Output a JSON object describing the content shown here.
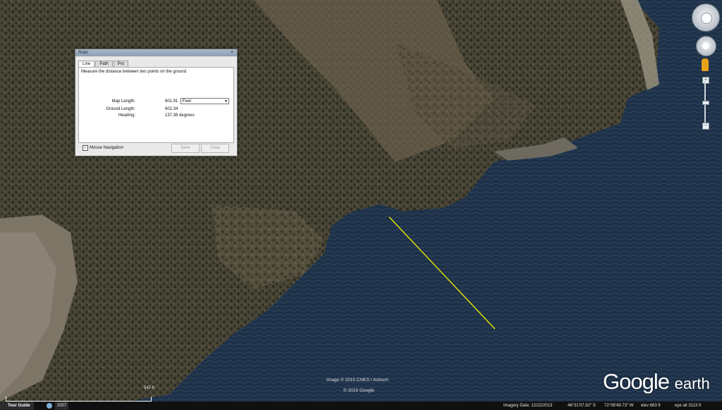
{
  "ruler": {
    "title": "Ruler",
    "close": "×",
    "tabs": [
      "Line",
      "Path",
      "Pro"
    ],
    "description": "Measure the distance between two points on the ground",
    "map_length_label": "Map Length:",
    "map_length_value": "601.91",
    "unit_selected": "Feet",
    "ground_length_label": "Ground Length:",
    "ground_length_value": "602.34",
    "heading_label": "Heading:",
    "heading_value": "137.38 degrees",
    "mouse_nav_label": "Mouse Navigation",
    "mouse_nav_checked": true,
    "save_label": "Save",
    "clear_label": "Clear"
  },
  "map": {
    "attribution_image": "Image © 2015 CNES / Astrium",
    "attribution_copy": "© 2015 Google",
    "logo_google": "Google",
    "logo_earth": "earth",
    "scale_label": "542 ft",
    "ruler_line_color": "#f0ef00"
  },
  "status": {
    "tour_guide": "Tour Guide",
    "year": "2007",
    "imagery_date": "Imagery Date: 12/22/2013",
    "lat": "46°31'07.82\" S",
    "lon": "72°08'49.73\" W",
    "elev": "elev   663 ft",
    "eye_alt": "eye alt   3113 ft"
  }
}
